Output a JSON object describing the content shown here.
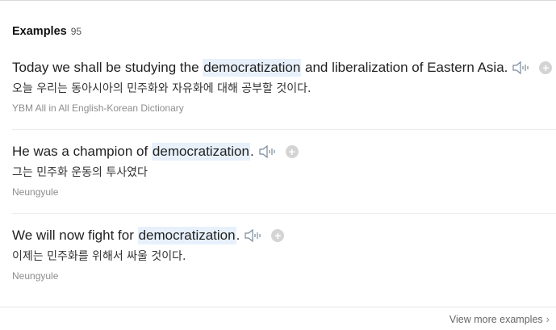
{
  "header": {
    "title": "Examples",
    "count": "95"
  },
  "examples": [
    {
      "en_before": "Today we shall be studying the ",
      "en_highlight": "democratization",
      "en_after": " and liberalization of Eastern Asia.",
      "ko": "오늘 우리는 동아시아의 민주화와 자유화에 대해 공부할 것이다.",
      "source": "YBM All in All English-Korean Dictionary"
    },
    {
      "en_before": "He was a champion of ",
      "en_highlight": "democratization",
      "en_after": ".",
      "ko": "그는 민주화 운동의 투사였다",
      "source": "Neungyule"
    },
    {
      "en_before": "We will now fight for ",
      "en_highlight": "democratization",
      "en_after": ".",
      "ko": "이제는 민주화를 위해서 싸울 것이다.",
      "source": "Neungyule"
    }
  ],
  "footer": {
    "more_label": "View more examples",
    "chevron": "›"
  },
  "icons": {
    "speaker": "speaker-icon",
    "add": "plus-icon"
  },
  "colors": {
    "highlight": "#e8f1fb",
    "source_text": "#8d8d8d",
    "plus_bg": "#d4d4d4"
  }
}
